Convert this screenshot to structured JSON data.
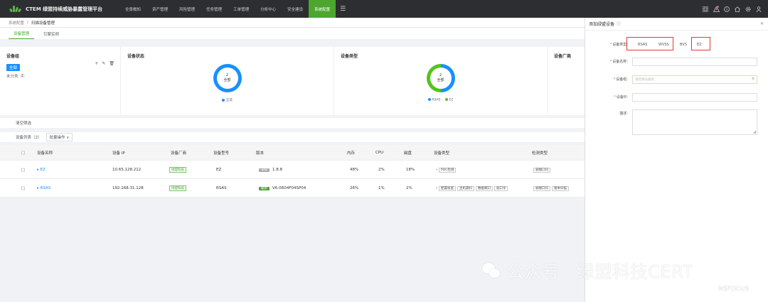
{
  "app": {
    "title": "CTEM 绿盟持续威胁暴露管理平台"
  },
  "nav": {
    "items": [
      "全景概知",
      "资产管理",
      "风险管理",
      "任务管理",
      "工单管理",
      "分析中心",
      "安全建设",
      "系统配置"
    ],
    "active_index": 7
  },
  "breadcrumb": {
    "parent": "系统配置",
    "sep": "/",
    "current": "扫描设备管理"
  },
  "tabs": [
    "设备管理",
    "引擎实例"
  ],
  "panels": {
    "group": {
      "title": "设备组",
      "all_label": "全部",
      "uncat_label": "未分类",
      "uncat_count": "2"
    },
    "status": {
      "title": "设备状态",
      "donut_value": "2",
      "donut_label": "全部",
      "legend": [
        {
          "label": "正常",
          "color": "#1890ff"
        }
      ]
    },
    "type": {
      "title": "设备类型",
      "donut_value": "2",
      "donut_label": "全部",
      "legend": [
        {
          "label": "RSAS",
          "color": "#1890ff"
        },
        {
          "label": "EZ",
          "color": "#52c41a"
        }
      ]
    },
    "vendor": {
      "title": "设备厂商"
    }
  },
  "filter": {
    "clear_label": "清空筛选"
  },
  "list": {
    "title": "设备列表（2）",
    "batch_label": "批量操作 ∨"
  },
  "table": {
    "headers": [
      "设备名称",
      "设备 IP",
      "设备厂商",
      "设备型号",
      "版本",
      "内存",
      "CPU",
      "磁盘",
      "设备类型",
      "检测类型"
    ],
    "rows": [
      {
        "name": "EZ",
        "ip": "10.65.128.212",
        "vendor": "绿盟科技",
        "model": "EZ",
        "ver_tag": "未知",
        "version": "1.8.8",
        "mem": "48%",
        "cpu": "2%",
        "disk": "18%",
        "types": [
          "POC检测"
        ],
        "checks": [
          "弱端口扫"
        ]
      },
      {
        "name": "RSAS",
        "ip": "192.168.31.128",
        "vendor": "绿盟科技",
        "model": "RSAS",
        "ver_tag": "最新",
        "version": "V6.0R04F04SP04",
        "mem": "26%",
        "cpu": "1%",
        "disk": "2%",
        "types": [
          "配置核查",
          "主机漏扫",
          "数据端口",
          "弱口令"
        ],
        "checks": [
          "弱端口扫",
          "版本扫描"
        ]
      }
    ]
  },
  "modal": {
    "title": "添加绿盟设备",
    "type_label": "设备类型",
    "type_options": [
      "RSAS",
      "WVSS",
      "BVS",
      "EZ"
    ],
    "name_label": "设备名称",
    "group_label": "设备组",
    "group_placeholder": "请选择设备组",
    "ip_label": "设备IP",
    "desc_label": "描述",
    "colon": ":",
    "star": "*"
  },
  "watermark": {
    "text": "公众号 · 绿盟科技CERT",
    "sub": "NSFOCUS"
  },
  "colors": {
    "accent": "#4ca72f",
    "blue": "#1890ff",
    "topbar": "#2d2e31",
    "highlight": "#e53935"
  }
}
